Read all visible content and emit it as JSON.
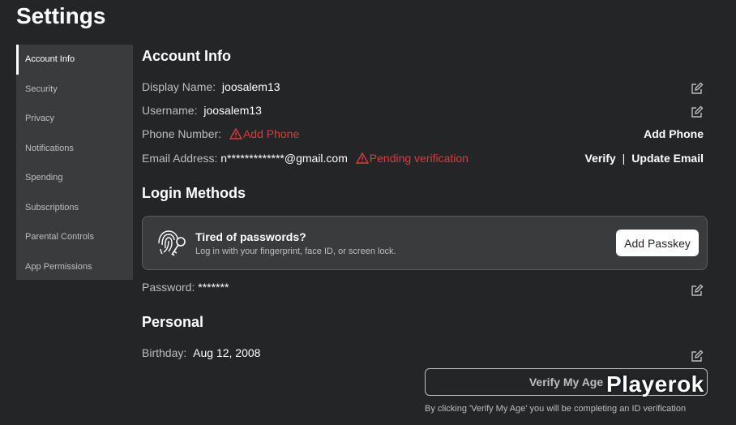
{
  "page": {
    "title": "Settings"
  },
  "sidebar": {
    "items": [
      {
        "label": "Account Info",
        "active": true
      },
      {
        "label": "Security"
      },
      {
        "label": "Privacy"
      },
      {
        "label": "Notifications"
      },
      {
        "label": "Spending"
      },
      {
        "label": "Subscriptions"
      },
      {
        "label": "Parental Controls"
      },
      {
        "label": "App Permissions"
      }
    ]
  },
  "account_info": {
    "title": "Account Info",
    "display_name": {
      "label": "Display Name:",
      "value": "joosalem13"
    },
    "username": {
      "label": "Username:",
      "value": "joosalem13"
    },
    "phone": {
      "label": "Phone Number:",
      "warning": "Add Phone",
      "action": "Add Phone"
    },
    "email": {
      "label": "Email Address:",
      "value": "n*************@gmail.com",
      "warning": "Pending verification",
      "verify": "Verify",
      "separator": "|",
      "update": "Update Email"
    }
  },
  "login_methods": {
    "title": "Login Methods",
    "passkey": {
      "title": "Tired of passwords?",
      "subtitle": "Log in with your fingerprint, face ID, or screen lock.",
      "button": "Add Passkey"
    },
    "password": {
      "label": "Password:",
      "value": "*******"
    }
  },
  "personal": {
    "title": "Personal",
    "birthday": {
      "label": "Birthday:",
      "value": "Aug 12, 2008"
    },
    "verify_age_button": "Verify My Age",
    "disclaimer": "By clicking 'Verify My Age' you will be completing an ID verification"
  },
  "watermark": "Playerok",
  "colors": {
    "background": "#232527",
    "sidebar": "#393b3d",
    "warning": "#e2393d"
  }
}
